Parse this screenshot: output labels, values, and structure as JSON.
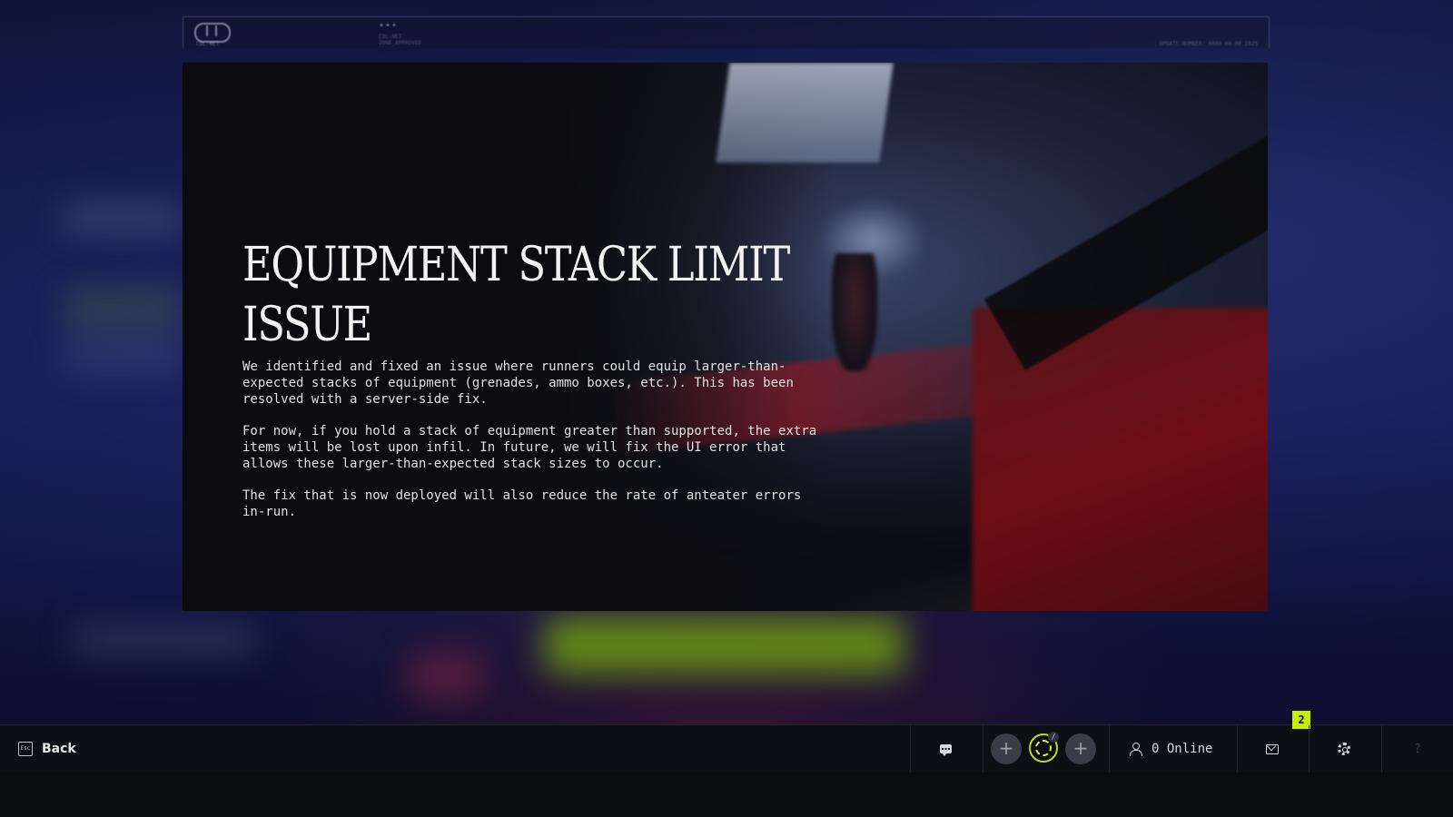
{
  "header": {
    "logo_text": "COL-NET",
    "mid_dots": "•••",
    "mid_line1": "COL-NET",
    "mid_line2": "ZONE_APPROVED",
    "right_text": "UPDATE NUMBER: 0000 00.00.2025"
  },
  "article": {
    "title": "EQUIPMENT STACK LIMIT ISSUE",
    "paragraphs": [
      "We identified and fixed an issue where runners could equip larger-than-\nexpected stacks of equipment (grenades, ammo boxes, etc.). This has been\nresolved with a server-side fix.",
      "For now, if you hold a stack of equipment greater than supported, the extra\nitems will be lost upon infil. In future, we will fix the UI error that\nallows these larger-than-expected stack sizes to occur.",
      "The fix that is now deployed will also reduce the rate of anteater errors\nin-run."
    ]
  },
  "bottom_bar": {
    "back_key": "Esc",
    "back_label": "Back",
    "add_slot_symbol": "+",
    "online_text": "0 Online",
    "mail_badge_count": "2",
    "help_symbol": "?"
  },
  "colors": {
    "accent": "#c4f000",
    "panel_bg": "#0c0c10",
    "bar_bg": "#0d0f14"
  }
}
